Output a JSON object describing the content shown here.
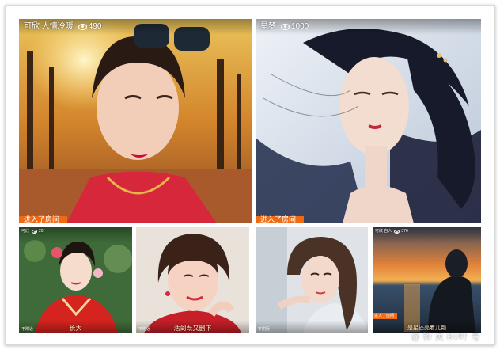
{
  "cards": [
    {
      "host": "可欣 人情冷暖",
      "viewers": "490",
      "tag": "进入了房间",
      "caption": "",
      "location": ""
    },
    {
      "host": "星梦",
      "viewers": "1000",
      "tag": "进入了房间",
      "caption": "",
      "location": ""
    },
    {
      "host": "可欣",
      "viewers": "20",
      "tag": "",
      "caption": "长大",
      "location": "不附近"
    },
    {
      "host": "",
      "viewers": "",
      "tag": "",
      "caption": "活到既又删下",
      "location": "不附近"
    },
    {
      "host": "",
      "viewers": "",
      "tag": "",
      "caption": "",
      "location": "不附近"
    },
    {
      "host": "可欣 自人",
      "viewers": "376",
      "tag": "进入了房间",
      "caption": "是星还亮着几颗",
      "location": ""
    }
  ],
  "watermark": "@ 钟 关 BV叶 号",
  "colors": {
    "tag_orange": "#f06a12",
    "frame_border": "#d9d9d9",
    "caption_text": "#ffe8c4"
  },
  "icons": [
    "eye-icon"
  ]
}
